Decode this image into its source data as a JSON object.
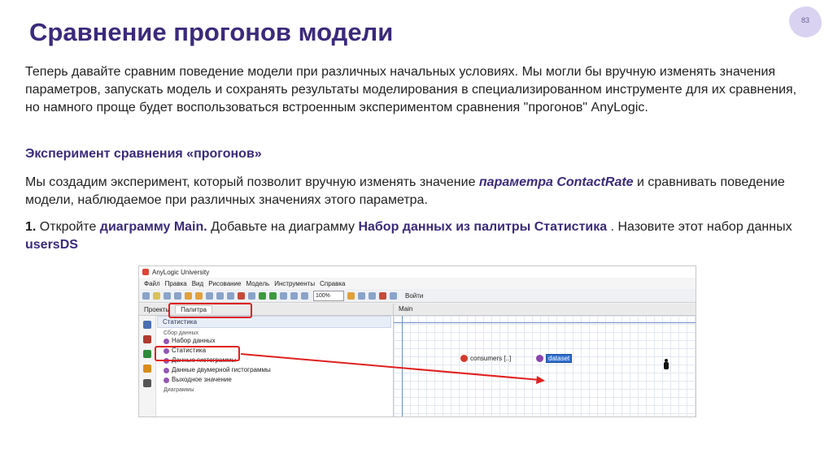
{
  "slide": {
    "title": "Сравнение прогонов модели",
    "page_number": "83"
  },
  "body": {
    "p1": "Теперь давайте сравним поведение модели при различных начальных условиях. Мы могли бы вручную изменять значения параметров, запускать модель и сохранять результаты моделирования в специализированном инструменте для их сравнения, но намного проще будет воспользоваться встроенным экспериментом сравнения \"прогонов\" AnyLogic.",
    "heading": "Эксперимент сравнения «прогонов»",
    "p2_a": "Мы создадим эксперимент, который позволит вручную изменять значение ",
    "p2_b": "параметра ContactRate",
    "p2_c": " и сравнивать поведение модели, наблюдаемое при различных значениях этого параметра.",
    "p3_num": "1.",
    "p3_a": " Откройте ",
    "p3_b": "диаграмму Main.",
    "p3_c": " Добавьте на диаграмму ",
    "p3_d": "Набор данных из палитры Статистика",
    "p3_e": " . Назовите этот набор данных ",
    "p3_f": "usersDS"
  },
  "screenshot": {
    "window_title": "AnyLogic University",
    "menu": [
      "Файл",
      "Правка",
      "Вид",
      "Рисование",
      "Модель",
      "Инструменты",
      "Справка"
    ],
    "zoom": "100%",
    "login": "Войти",
    "tabs": [
      "Проекты",
      "Палитра"
    ],
    "palette_section": "Статистика",
    "group1": "Сбор данных",
    "items": [
      "Набор данных",
      "Статистика",
      "Данные гистограммы",
      "Данные двумерной гистограммы",
      "Выходное значение"
    ],
    "group2": "Диаграммы",
    "editor_tab": "Main",
    "consumers_label": "consumers [..]",
    "dataset_label": "dataset"
  },
  "colors": {
    "title": "#3b2a7c",
    "highlight": "#e02020"
  }
}
